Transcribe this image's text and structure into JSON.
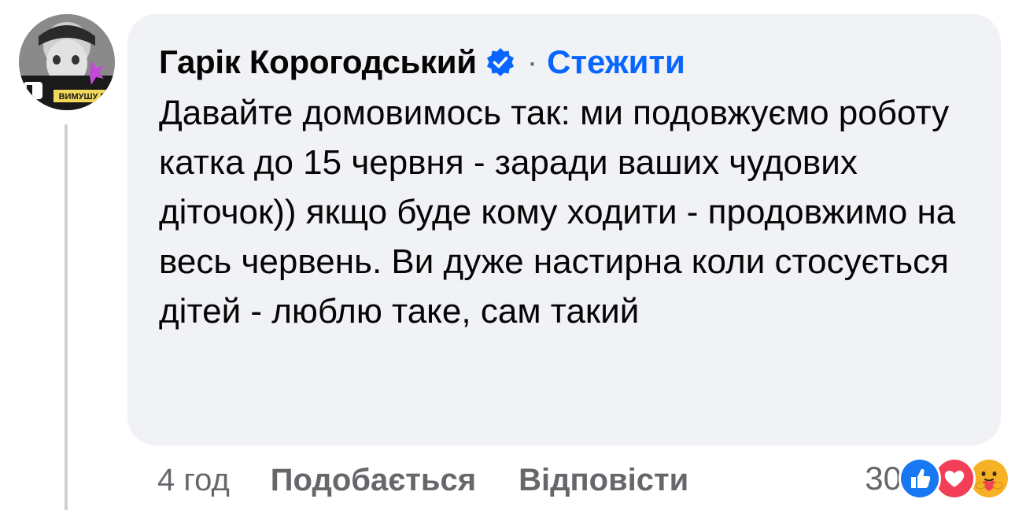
{
  "comment": {
    "author": "Гарік Корогодський",
    "follow_label": "Стежити",
    "separator": "·",
    "text": "Давайте домовимось так: ми подовжуємо роботу катка до 15 червня - заради ваших чудових діточок)) якщо буде кому ходити - продовжимо на весь червень. Ви дуже настирна коли стосується дітей - люблю таке, сам такий",
    "timestamp": "4 год",
    "like_label": "Подобається",
    "reply_label": "Відповісти",
    "reaction_count": "30",
    "reactions": [
      "like-icon",
      "love-icon",
      "care-icon"
    ],
    "avatar_text": "ВИМУШУ В"
  },
  "colors": {
    "bubble": "#f0f2f5",
    "link": "#0866ff",
    "secondary_text": "#65676b",
    "primary_text": "#050505",
    "like": "#1877f2",
    "love": "#f33e58",
    "care": "#f7b125"
  }
}
